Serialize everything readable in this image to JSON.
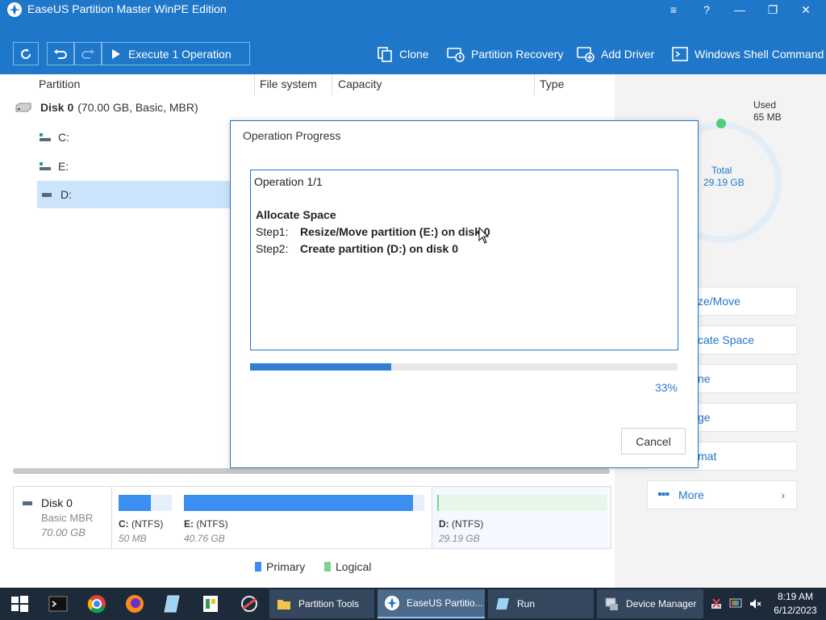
{
  "window": {
    "title": "EaseUS Partition Master WinPE Edition",
    "controls": [
      "≡",
      "?",
      "—",
      "❐",
      "✕"
    ]
  },
  "toolbar": {
    "execute_label": "Execute 1 Operation",
    "clone_label": "Clone",
    "partition_recovery_label": "Partition Recovery",
    "add_driver_label": "Add Driver",
    "windows_shell_label": "Windows Shell Command"
  },
  "partition_table": {
    "columns": [
      "Partition",
      "File system",
      "Capacity",
      "Type"
    ],
    "disk": {
      "name": "Disk 0",
      "info": "(70.00 GB, Basic, MBR)"
    },
    "partitions": [
      {
        "label": "C:",
        "selected": false
      },
      {
        "label": "E:",
        "selected": false
      },
      {
        "label": "D:",
        "selected": true
      }
    ]
  },
  "disk_map": {
    "disk_name": "Disk 0",
    "disk_type": "Basic MBR",
    "disk_size": "70.00 GB",
    "partitions": [
      {
        "label": "C:",
        "fs": "(NTFS)",
        "size": "50 MB"
      },
      {
        "label": "E:",
        "fs": "(NTFS)",
        "size": "40.76 GB"
      },
      {
        "label": "D:",
        "fs": "(NTFS)",
        "size": "29.19 GB"
      }
    ]
  },
  "legend": {
    "primary": "Primary",
    "logical": "Logical"
  },
  "usage": {
    "used_label": "Used",
    "used_value": "65 MB",
    "total_label": "Total",
    "total_value": "29.19 GB"
  },
  "side_actions": {
    "items": [
      "ze/Move",
      "cate Space",
      "ne",
      "ge",
      "mat"
    ],
    "more_label": "More"
  },
  "dialog": {
    "title": "Operation Progress",
    "operation_counter": "Operation 1/1",
    "operation_name": "Allocate Space",
    "steps": [
      {
        "label": "Step1:",
        "text": "Resize/Move partition (E:) on disk 0"
      },
      {
        "label": "Step2:",
        "text": "Create partition (D:) on disk 0"
      }
    ],
    "progress_fraction": 0.33,
    "progress_text": "33%",
    "cancel_label": "Cancel"
  },
  "taskbar": {
    "items": [
      {
        "label": "Partition Tools"
      },
      {
        "label": "EaseUS Partitio..."
      },
      {
        "label": "Run"
      },
      {
        "label": "Device Manager"
      }
    ],
    "time": "8:19 AM",
    "date": "6/12/2023"
  },
  "colors": {
    "accent": "#1f77c9",
    "primary_partition": "#3b8ff0",
    "logical_partition": "#7ed18f"
  }
}
